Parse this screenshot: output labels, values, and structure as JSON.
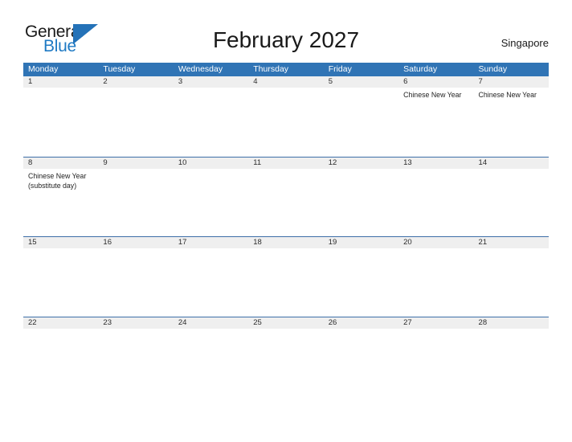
{
  "brand": {
    "word_one": "General",
    "word_two": "Blue",
    "triangle_icon": "blue-triangle-icon",
    "colors": {
      "general_text": "#1a1a1a",
      "blue_text": "#1f7ac4",
      "triangle": "#2472b8"
    }
  },
  "header": {
    "title": "February 2027",
    "region": "Singapore"
  },
  "calendar": {
    "accent_color": "#3074b5",
    "daynum_band_color": "#efefef",
    "row_divider_color": "#3d6fa8",
    "weekdays": [
      "Monday",
      "Tuesday",
      "Wednesday",
      "Thursday",
      "Friday",
      "Saturday",
      "Sunday"
    ],
    "weeks": [
      [
        {
          "day": "1",
          "events": []
        },
        {
          "day": "2",
          "events": []
        },
        {
          "day": "3",
          "events": []
        },
        {
          "day": "4",
          "events": []
        },
        {
          "day": "5",
          "events": []
        },
        {
          "day": "6",
          "events": [
            "Chinese New Year"
          ]
        },
        {
          "day": "7",
          "events": [
            "Chinese New Year"
          ]
        }
      ],
      [
        {
          "day": "8",
          "events": [
            "Chinese New Year (substitute day)"
          ]
        },
        {
          "day": "9",
          "events": []
        },
        {
          "day": "10",
          "events": []
        },
        {
          "day": "11",
          "events": []
        },
        {
          "day": "12",
          "events": []
        },
        {
          "day": "13",
          "events": []
        },
        {
          "day": "14",
          "events": []
        }
      ],
      [
        {
          "day": "15",
          "events": []
        },
        {
          "day": "16",
          "events": []
        },
        {
          "day": "17",
          "events": []
        },
        {
          "day": "18",
          "events": []
        },
        {
          "day": "19",
          "events": []
        },
        {
          "day": "20",
          "events": []
        },
        {
          "day": "21",
          "events": []
        }
      ],
      [
        {
          "day": "22",
          "events": []
        },
        {
          "day": "23",
          "events": []
        },
        {
          "day": "24",
          "events": []
        },
        {
          "day": "25",
          "events": []
        },
        {
          "day": "26",
          "events": []
        },
        {
          "day": "27",
          "events": []
        },
        {
          "day": "28",
          "events": []
        }
      ]
    ]
  }
}
